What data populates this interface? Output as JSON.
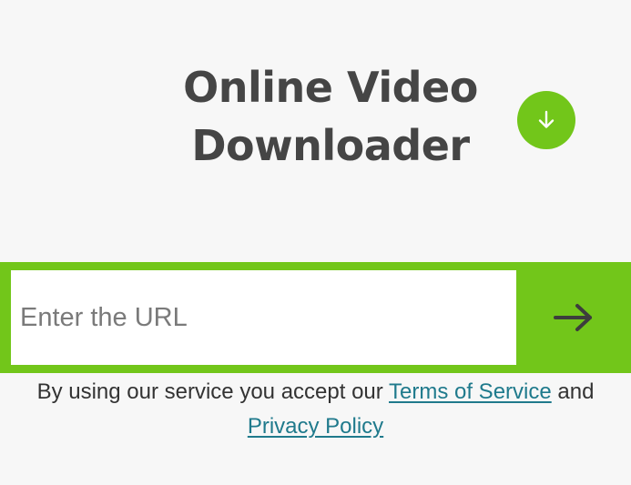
{
  "title": "Online Video Downloader",
  "icons": {
    "download": "arrow-down-circle-icon",
    "submit": "arrow-right-icon"
  },
  "url_input": {
    "placeholder": "Enter the URL",
    "value": ""
  },
  "consent": {
    "prefix": "By using our service you accept our ",
    "terms_link": "Terms of Service",
    "conjunction": " and ",
    "privacy_link": "Privacy Policy"
  },
  "colors": {
    "accent_green": "#72c61a",
    "title_text": "#454545",
    "link": "#1f7a8c",
    "background": "#f7f7f7"
  }
}
